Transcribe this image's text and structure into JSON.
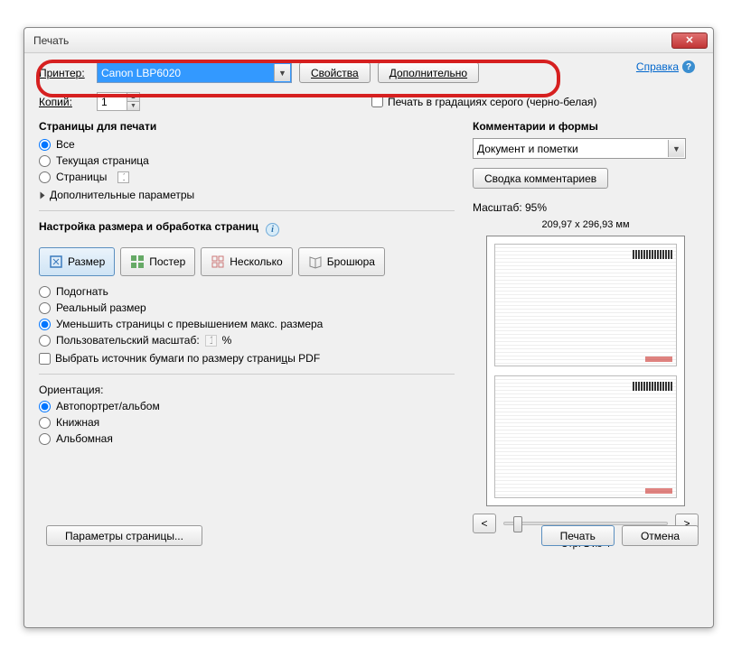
{
  "window": {
    "title": "Печать"
  },
  "help_link": "Справка",
  "printer": {
    "label": "Принтер:",
    "value": "Canon LBP6020",
    "properties_btn": "Свойства",
    "advanced_btn": "Дополнительно"
  },
  "copies": {
    "label": "Копий:",
    "value": "1"
  },
  "grayscale": "Печать в градациях серого (черно-белая)",
  "pages_section": {
    "title": "Страницы для печати",
    "all": "Все",
    "current": "Текущая страница",
    "range_label": "Страницы",
    "range_value": "1 - 4",
    "more": "Дополнительные параметры"
  },
  "size_section": {
    "title": "Настройка размера и обработка страниц",
    "btns": {
      "size": "Размер",
      "poster": "Постер",
      "multiple": "Несколько",
      "booklet": "Брошюра"
    },
    "fit": "Подогнать",
    "actual": "Реальный размер",
    "shrink": "Уменьшить страницы с превышением макс. размера",
    "custom_label": "Пользовательский масштаб:",
    "custom_value": "100",
    "percent": "%",
    "paper_source": "Выбрать источник бумаги по размеру страницы PDF"
  },
  "orientation": {
    "title": "Ориентация:",
    "auto": "Автопортрет/альбом",
    "portrait": "Книжная",
    "landscape": "Альбомная"
  },
  "comments": {
    "title": "Комментарии и формы",
    "combo": "Документ и пометки",
    "summary_btn": "Сводка комментариев"
  },
  "preview": {
    "scale": "Масштаб:  95%",
    "dims": "209,97 x 296,93 мм",
    "page_of": "Стр. 1 из 4",
    "prev": "<",
    "next": ">"
  },
  "footer": {
    "page_setup": "Параметры страницы...",
    "print": "Печать",
    "cancel": "Отмена"
  }
}
